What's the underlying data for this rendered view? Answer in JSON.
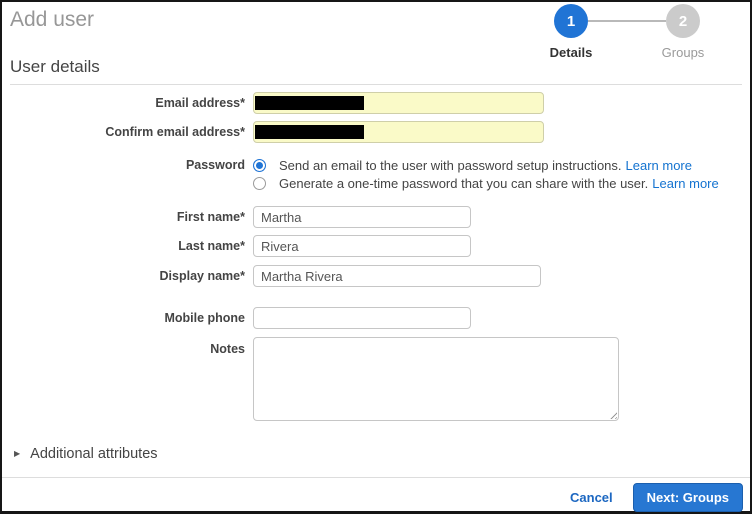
{
  "page": {
    "title": "Add user"
  },
  "steps": {
    "step1": {
      "number": "1",
      "label": "Details"
    },
    "step2": {
      "number": "2",
      "label": "Groups"
    }
  },
  "section": {
    "title": "User details"
  },
  "form": {
    "email": {
      "label": "Email address*",
      "value": ""
    },
    "confirm_email": {
      "label": "Confirm email address*",
      "value": ""
    },
    "password": {
      "label": "Password",
      "option1": {
        "text": "Send an email to the user with password setup instructions.",
        "link": "Learn more",
        "selected": true
      },
      "option2": {
        "text": "Generate a one-time password that you can share with the user.",
        "link": "Learn more",
        "selected": false
      }
    },
    "first_name": {
      "label": "First name*",
      "value": "Martha"
    },
    "last_name": {
      "label": "Last name*",
      "value": "Rivera"
    },
    "display_name": {
      "label": "Display name*",
      "value": "Martha Rivera"
    },
    "mobile_phone": {
      "label": "Mobile phone",
      "value": ""
    },
    "notes": {
      "label": "Notes",
      "value": ""
    }
  },
  "additional": {
    "label": "Additional attributes"
  },
  "footer": {
    "cancel": "Cancel",
    "next": "Next: Groups"
  },
  "icons": {
    "chevron_right": "▶"
  },
  "colors": {
    "accent": "#2074d5",
    "link": "#1473d0",
    "step_inactive": "#cbcbcb",
    "email_field_bg": "#fafac8",
    "redaction": "#000000"
  }
}
